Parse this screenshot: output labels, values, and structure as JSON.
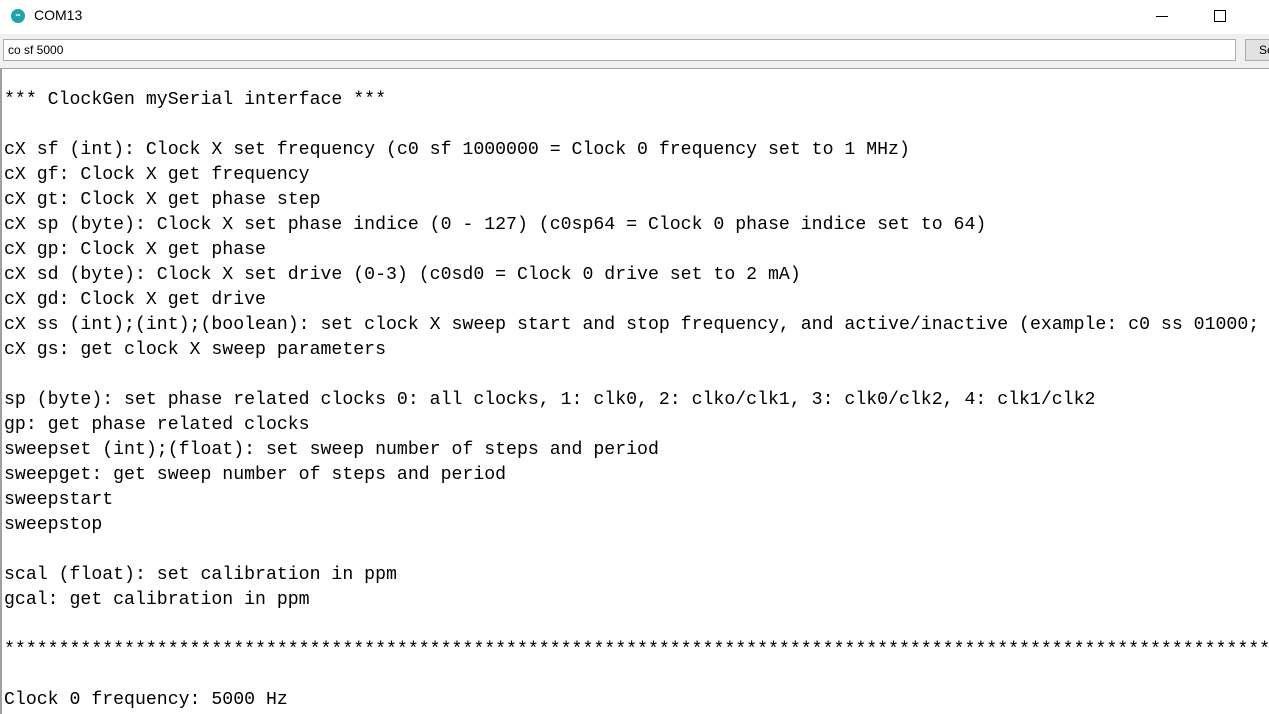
{
  "window": {
    "title": "COM13",
    "icon": "arduino-icon"
  },
  "input": {
    "value": "co sf 5000",
    "send_label": "Send"
  },
  "output": {
    "lines": [
      "",
      "*** ClockGen mySerial interface ***",
      "",
      "cX sf (int): Clock X set frequency (c0 sf 1000000 = Clock 0 frequency set to 1 MHz)",
      "cX gf: Clock X get frequency",
      "cX gt: Clock X get phase step",
      "cX sp (byte): Clock X set phase indice (0 - 127) (c0sp64 = Clock 0 phase indice set to 64)",
      "cX gp: Clock X get phase",
      "cX sd (byte): Clock X set drive (0-3) (c0sd0 = Clock 0 drive set to 2 mA)",
      "cX gd: Clock X get drive",
      "cX ss (int);(int);(boolean): set clock X sweep start and stop frequency, and active/inactive (example: c0 ss 01000;",
      "cX gs: get clock X sweep parameters",
      "",
      "sp (byte): set phase related clocks 0: all clocks, 1: clk0, 2: clko/clk1, 3: clk0/clk2, 4: clk1/clk2",
      "gp: get phase related clocks",
      "sweepset (int);(float): set sweep number of steps and period",
      "sweepget: get sweep number of steps and period",
      "sweepstart",
      "sweepstop",
      "",
      "scal (float): set calibration in ppm",
      "gcal: get calibration in ppm",
      "",
      "************************************************************************************************************************",
      "",
      "Clock 0 frequency: 5000 Hz"
    ]
  }
}
